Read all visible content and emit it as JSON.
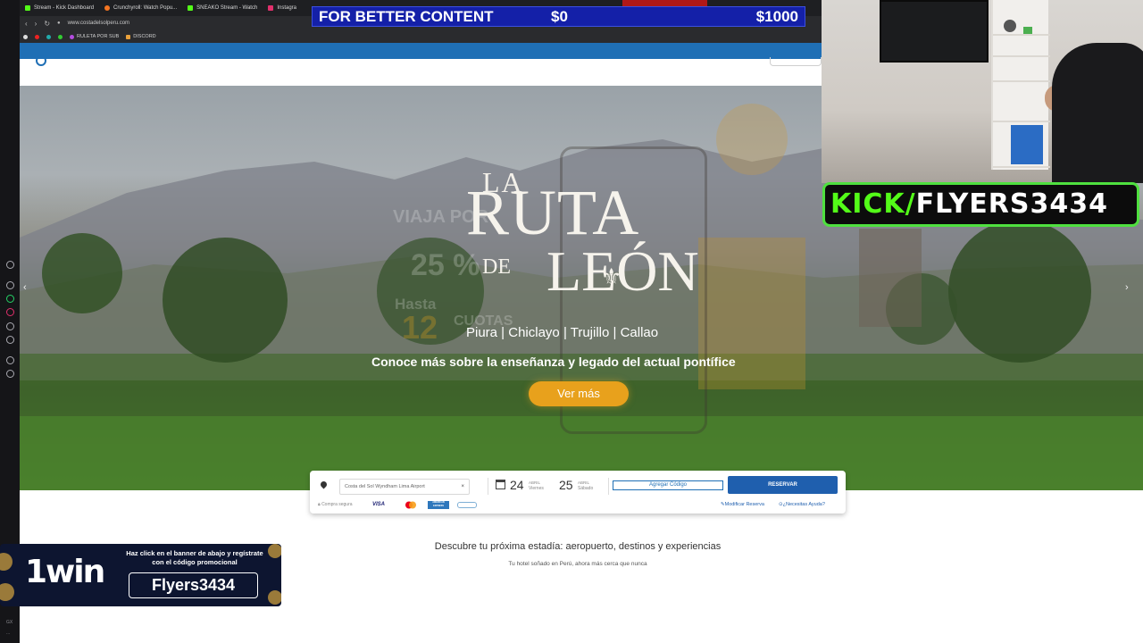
{
  "browser": {
    "tabs": [
      {
        "label": "Stream - Kick Dashboard",
        "color": "#53fc18"
      },
      {
        "label": "Crunchyroll: Watch Popu...",
        "color": "#f47521"
      },
      {
        "label": "SNEAKO Stream - Watch",
        "color": "#53fc18"
      },
      {
        "label": "Instagra",
        "color": "#e1306c"
      }
    ],
    "url": "www.costadelsolperu.com",
    "bookmarks": [
      {
        "label": "RULETA POR SUB"
      },
      {
        "label": "DISCORD"
      }
    ]
  },
  "stream_banner": {
    "left": "FOR BETTER CONTENT",
    "middle": "$0",
    "right": "$1000"
  },
  "hero": {
    "title_la": "LA",
    "title_ruta": "RUTA",
    "title_de": "DE",
    "title_leon": "LEÓN",
    "cities": "Piura | Chiclayo | Trujillo | Callao",
    "subtitle": "Conoce más sobre la enseñanza y legado del actual pontífice",
    "cta": "Ver más",
    "ghost": {
      "viaja": "VIAJA POR",
      "pct": "25 %",
      "hasta": "Hasta",
      "n12": "12",
      "cuotas": "CUOTAS"
    },
    "arrow_left": "‹",
    "arrow_right": "›"
  },
  "booking": {
    "hotel": "Costa del Sol Wyndham Lima Airport",
    "clear": "×",
    "checkin_day": "24",
    "checkin_month": "ABRIL",
    "checkin_weekday": "Viernes",
    "checkout_day": "25",
    "checkout_month": "ABRIL",
    "checkout_weekday": "Sábado",
    "code_button": "Agregar Código",
    "reserve_button": "RESERVAR",
    "secure_label": "Compra segura",
    "cards": [
      "VISA",
      "AMERICAN EXPRESS"
    ],
    "modify_link": "Modificar Reserva",
    "help_link": "¿Necesitas Ayuda?"
  },
  "content": {
    "title": "Descubre tu próxima estadía: aeropuerto, destinos y experiencias",
    "subtitle": "Tu hotel soñado en Perú, ahora más cerca que nunca"
  },
  "kick_overlay": {
    "prefix": "KICK/",
    "handle": "FLYERS3434"
  },
  "promo": {
    "brand": "1win",
    "text": "Haz click en el banner de abajo y regístrate con el código promocional",
    "code": "Flyers3434"
  },
  "rail_bottom": [
    "GX",
    "..."
  ]
}
